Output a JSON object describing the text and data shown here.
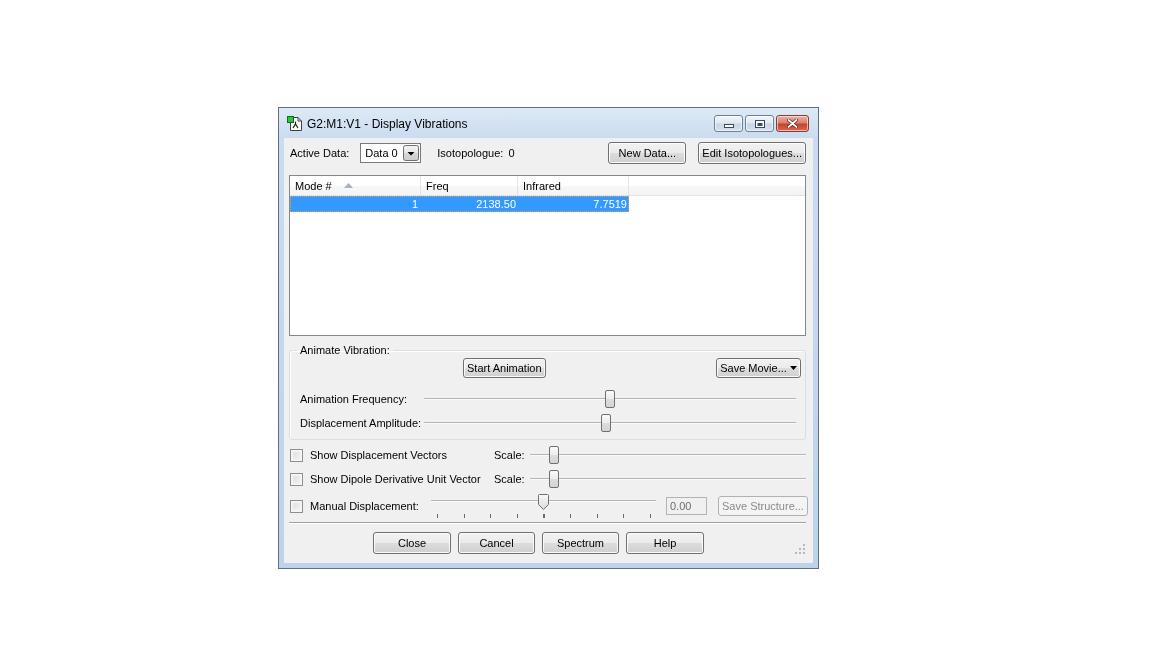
{
  "window": {
    "title": "G2:M1:V1 - Display Vibrations"
  },
  "toolbar": {
    "active_data": {
      "label": "Active Data:",
      "value": "Data 0"
    },
    "isotopologue": {
      "label": "Isotopologue:",
      "value": "0"
    },
    "buttons": [
      "New Data...",
      "Edit Isotopologues..."
    ]
  },
  "table": {
    "columns": [
      {
        "label": "Mode #",
        "sorted": true
      },
      {
        "label": "Freq",
        "sorted": false
      },
      {
        "label": "Infrared",
        "sorted": false
      }
    ],
    "rows": [
      {
        "selected": true,
        "cells": [
          "1",
          "2138.50",
          "7.7519"
        ]
      }
    ]
  },
  "animate_vibration": {
    "title": "Animate Vibration:",
    "start_button": "Start Animation",
    "save_button": "Save Movie...",
    "sliders": [
      {
        "label": "Animation Frequency:",
        "level": 0.5
      },
      {
        "label": "Displacement Amplitude:",
        "level": 0.49
      }
    ]
  },
  "options": [
    {
      "kind": "scale",
      "label": "Show Displacement Vectors",
      "checked": false,
      "scale_label": "Scale:",
      "level": 0.07
    },
    {
      "kind": "scale",
      "label": "Show Dipole Derivative Unit Vector",
      "checked": false,
      "scale_label": "Scale:",
      "level": 0.07
    },
    {
      "kind": "manual",
      "label": "Manual Displacement:",
      "checked": false,
      "level": 0.5,
      "value": "0.00",
      "value_disabled": true,
      "button": "Save Structure...",
      "button_disabled": true
    }
  ],
  "buttons": [
    "Close",
    "Cancel",
    "Spectrum",
    "Help"
  ]
}
